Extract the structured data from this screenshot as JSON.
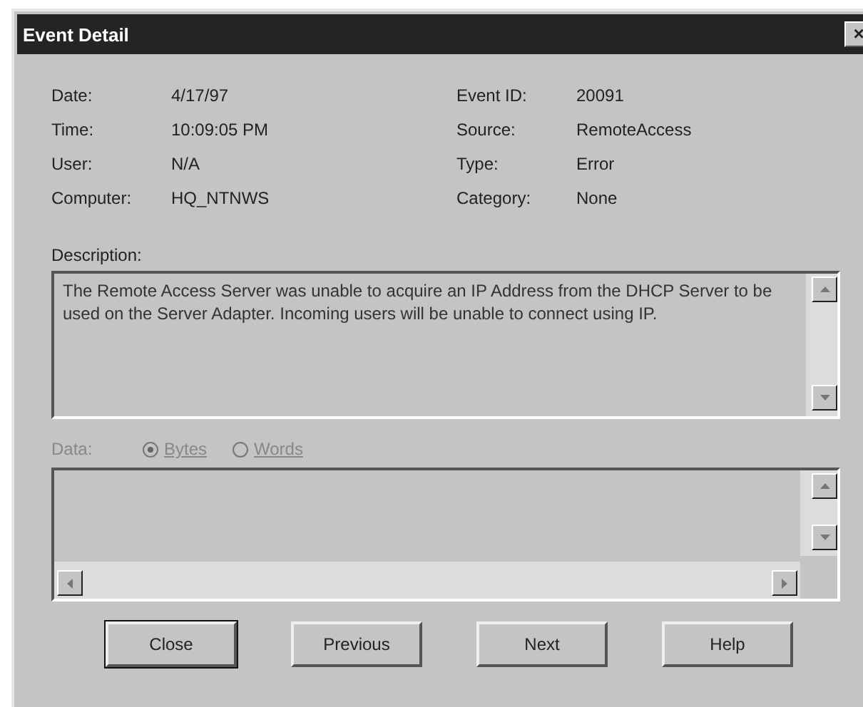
{
  "window": {
    "title": "Event Detail",
    "close_glyph": "×"
  },
  "fields": [
    {
      "label": "Date:",
      "value": "4/17/97"
    },
    {
      "label": "Event ID:",
      "value": "20091"
    },
    {
      "label": "Time:",
      "value": "10:09:05 PM"
    },
    {
      "label": "Source:",
      "value": "RemoteAccess"
    },
    {
      "label": "User:",
      "value": "N/A"
    },
    {
      "label": "Type:",
      "value": "Error"
    },
    {
      "label": "Computer:",
      "value": "HQ_NTNWS"
    },
    {
      "label": "Category:",
      "value": "None"
    }
  ],
  "description": {
    "label": "Description:",
    "text": "The Remote Access Server was unable to acquire an IP Address from the DHCP Server to be used on the Server Adapter. Incoming users will be unable to connect using IP."
  },
  "data": {
    "label": "Data:",
    "disabled": true,
    "options": [
      {
        "label": "Bytes",
        "selected": true
      },
      {
        "label": "Words",
        "selected": false
      }
    ]
  },
  "buttons": [
    {
      "label": "Close",
      "default": true
    },
    {
      "label": "Previous",
      "default": false
    },
    {
      "label": "Next",
      "default": false
    },
    {
      "label": "Help",
      "default": false
    }
  ]
}
